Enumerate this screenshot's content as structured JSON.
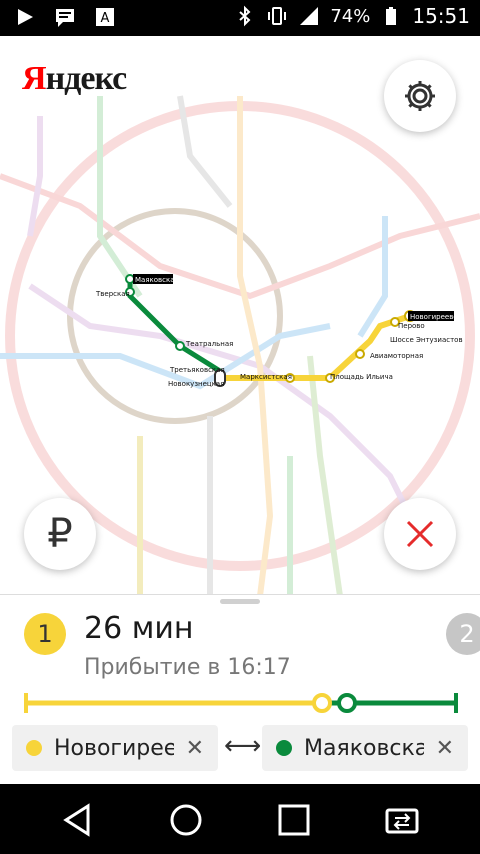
{
  "status_bar": {
    "battery": "74%",
    "time": "15:51"
  },
  "map": {
    "logo_first": "Я",
    "logo_rest": "ндекс",
    "station_labels": {
      "mayakovskaya": "Маяковская",
      "tverskaya": "Тверская",
      "teatralnaya": "Театральная",
      "tretyakovskaya": "Третьяковская",
      "novokuznetskaya": "Новокузнецкая",
      "marksistskaya": "Марксистская",
      "ploshchad_ilyicha": "Площадь Ильича",
      "aviamotornaya": "Авиамоторная",
      "shosse_entuziastov": "Шоссе Энтузиастов",
      "perovo": "Перово",
      "novogireevo": "Новогиреево"
    },
    "colors": {
      "yellow_line": "#f7d43a",
      "green_line": "#0a8a3c",
      "accent_red": "#e52b2b"
    }
  },
  "buttons": {
    "ruble": "₽"
  },
  "route": {
    "option_primary": "1",
    "option_secondary": "2",
    "duration": "26 мин",
    "arrival": "Прибытие в 16:17",
    "from": "Новогиреево",
    "to": "Маяковская",
    "swap_icon": "⟷",
    "clear_icon": "✕"
  }
}
